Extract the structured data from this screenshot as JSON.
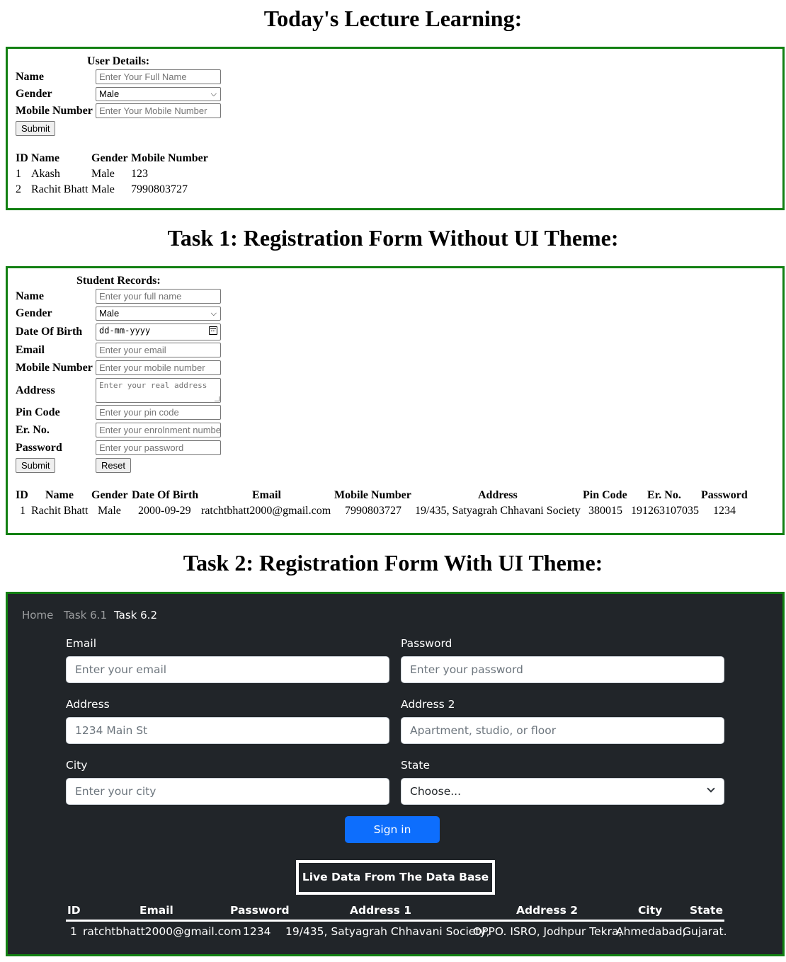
{
  "titles": {
    "lecture": "Today's Lecture Learning:",
    "task1": "Task 1: Registration Form Without UI Theme:",
    "task2": "Task 2: Registration Form With UI Theme:"
  },
  "user_details": {
    "caption": "User Details:",
    "name_label": "Name",
    "name_placeholder": "Enter Your Full Name",
    "gender_label": "Gender",
    "gender_value": "Male",
    "mobile_label": "Mobile Number",
    "mobile_placeholder": "Enter Your Mobile Number",
    "submit_label": "Submit",
    "table": {
      "headers": [
        "ID",
        "Name",
        "Gender",
        "Mobile Number"
      ],
      "rows": [
        [
          "1",
          "Akash",
          "Male",
          "123"
        ],
        [
          "2",
          "Rachit Bhatt",
          "Male",
          "7990803727"
        ]
      ]
    }
  },
  "student_records": {
    "caption": "Student Records:",
    "name_label": "Name",
    "name_placeholder": "Enter your full name",
    "gender_label": "Gender",
    "gender_value": "Male",
    "dob_label": "Date Of Birth",
    "dob_value": "dd-mm-yyyy",
    "email_label": "Email",
    "email_placeholder": "Enter your email",
    "mobile_label": "Mobile Number",
    "mobile_placeholder": "Enter your mobile number",
    "address_label": "Address",
    "address_placeholder": "Enter your real address",
    "pin_label": "Pin Code",
    "pin_placeholder": "Enter your pin code",
    "erno_label": "Er. No.",
    "erno_placeholder": "Enter your enrolnment number",
    "password_label": "Password",
    "password_placeholder": "Enter your password",
    "submit_label": "Submit",
    "reset_label": "Reset",
    "table": {
      "headers": [
        "ID",
        "Name",
        "Gender",
        "Date Of Birth",
        "Email",
        "Mobile Number",
        "Address",
        "Pin Code",
        "Er. No.",
        "Password"
      ],
      "rows": [
        [
          "1",
          "Rachit Bhatt",
          "Male",
          "2000-09-29",
          "ratchtbhatt2000@gmail.com",
          "7990803727",
          "19/435, Satyagrah Chhavani Society",
          "380015",
          "191263107035",
          "1234"
        ]
      ]
    }
  },
  "themed": {
    "nav": [
      "Home",
      "Task 6.1",
      "Task 6.2"
    ],
    "email_label": "Email",
    "email_placeholder": "Enter your email",
    "password_label": "Password",
    "password_placeholder": "Enter your password",
    "address_label": "Address",
    "address_placeholder": "1234 Main St",
    "address2_label": "Address 2",
    "address2_placeholder": "Apartment, studio, or floor",
    "city_label": "City",
    "city_placeholder": "Enter your city",
    "state_label": "State",
    "state_value": "Choose...",
    "signin_label": "Sign in",
    "live_label": "Live Data From The Data Base",
    "table": {
      "headers": [
        "ID",
        "Email",
        "Password",
        "Address 1",
        "Address 2",
        "City",
        "State"
      ],
      "rows": [
        [
          "1",
          "ratchtbhatt2000@gmail.com",
          "1234",
          "19/435, Satyagrah Chhavani Society,",
          "OPPO. ISRO, Jodhpur Tekra,",
          "Ahmedabad,",
          "Gujarat."
        ]
      ]
    }
  },
  "colors": {
    "box_border": "#128012",
    "dark_bg": "#212529",
    "primary": "#0d6efd"
  }
}
